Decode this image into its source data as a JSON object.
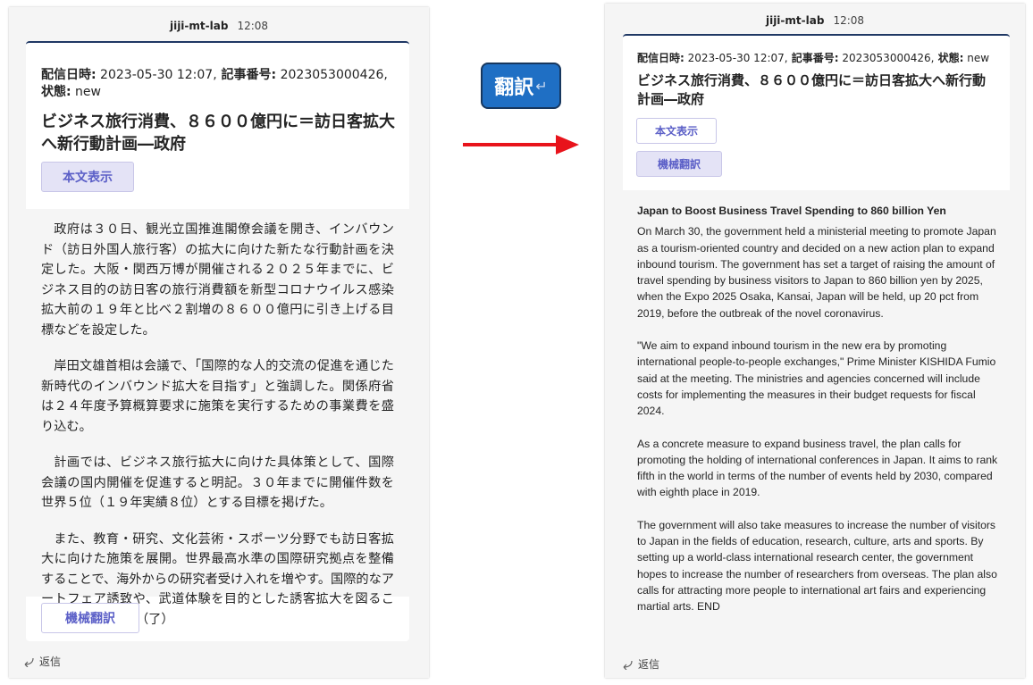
{
  "left": {
    "sender": "jiji-mt-lab",
    "time": "12:08",
    "meta_date_label": "配信日時:",
    "meta_date": " 2023-05-30 12:07,",
    "meta_id_label": " 記事番号:",
    "meta_id": " 2023053000426,",
    "meta_state_label": " 状態:",
    "meta_state": " new",
    "title": "ビジネス旅行消費、８６００億円に＝訪日客拡大へ新行動計画―政府",
    "show_body_label": "本文表示",
    "paragraphs": [
      "政府は３０日、観光立国推進閣僚会議を開き、インバウンド（訪日外国人旅行客）の拡大に向けた新たな行動計画を決定した。大阪・関西万博が開催される２０２５年までに、ビジネス目的の訪日客の旅行消費額を新型コロナウイルス感染拡大前の１９年と比べ２割増の８６００億円に引き上げる目標などを設定した。",
      "岸田文雄首相は会議で、「国際的な人的交流の促進を通じた新時代のインバウンド拡大を目指す」と強調した。関係府省は２４年度予算概算要求に施策を実行するための事業費を盛り込む。",
      "計画では、ビジネス旅行拡大に向けた具体策として、国際会議の国内開催を促進すると明記。３０年までに開催件数を世界５位（１９年実績８位）とする目標を掲げた。",
      "また、教育・研究、文化芸術・スポーツ分野でも訪日客拡大に向けた施策を展開。世界最高水準の国際研究拠点を整備することで、海外からの研究者受け入れを増やす。国際的なアートフェア誘致や、武道体験を目的とした誘客拡大を図ることも盛り込んだ。（了）"
    ],
    "mt_label": "機械翻訳",
    "reply_label": "返信"
  },
  "center": {
    "translate_label": "翻訳",
    "enter_glyph": "↵"
  },
  "right": {
    "sender": "jiji-mt-lab",
    "time": "12:08",
    "meta_date_label": "配信日時:",
    "meta_date": " 2023-05-30 12:07,",
    "meta_id_label": " 記事番号:",
    "meta_id": " 2023053000426,",
    "meta_state_label": " 状態:",
    "meta_state": " new",
    "title": "ビジネス旅行消費、８６００億円に＝訪日客拡大へ新行動計画―政府",
    "show_body_label": "本文表示",
    "mt_label": "機械翻訳",
    "en_title": "Japan to Boost Business Travel Spending to 860 billion Yen",
    "paragraphs": [
      "On March 30, the government held a ministerial meeting to promote Japan as a tourism-oriented country and decided on a new action plan to expand inbound tourism. The government has set a target of raising the amount of travel spending by business visitors to Japan to 860 billion yen by 2025, when the Expo 2025 Osaka, Kansai, Japan will be held, up 20 pct from 2019, before the outbreak of the novel coronavirus.",
      "\"We aim to expand inbound tourism in the new era by promoting international people-to-people exchanges,\" Prime Minister KISHIDA Fumio said at the meeting. The ministries and agencies concerned will include costs for implementing the measures in their budget requests for fiscal 2024.",
      "As a concrete measure to expand business travel, the plan calls for promoting the holding of international conferences in Japan. It aims to rank fifth in the world in terms of the number of events held by 2030, compared with eighth place in 2019.",
      "The government will also take measures to increase the number of visitors to Japan in the fields of education, research, culture, arts and sports. By setting up a world-class international research center, the government hopes to increase the number of researchers from overseas. The plan also calls for attracting more people to international art fairs and experiencing martial arts. END"
    ],
    "reply_label": "返信"
  },
  "colors": {
    "accent": "#5b5fc7",
    "card_border": "#1f3864",
    "translate_button": "#1f6fc4",
    "arrow": "#e8131b"
  },
  "icons": [
    "reply-arrow-icon",
    "enter-key-icon",
    "red-right-arrow-icon"
  ]
}
